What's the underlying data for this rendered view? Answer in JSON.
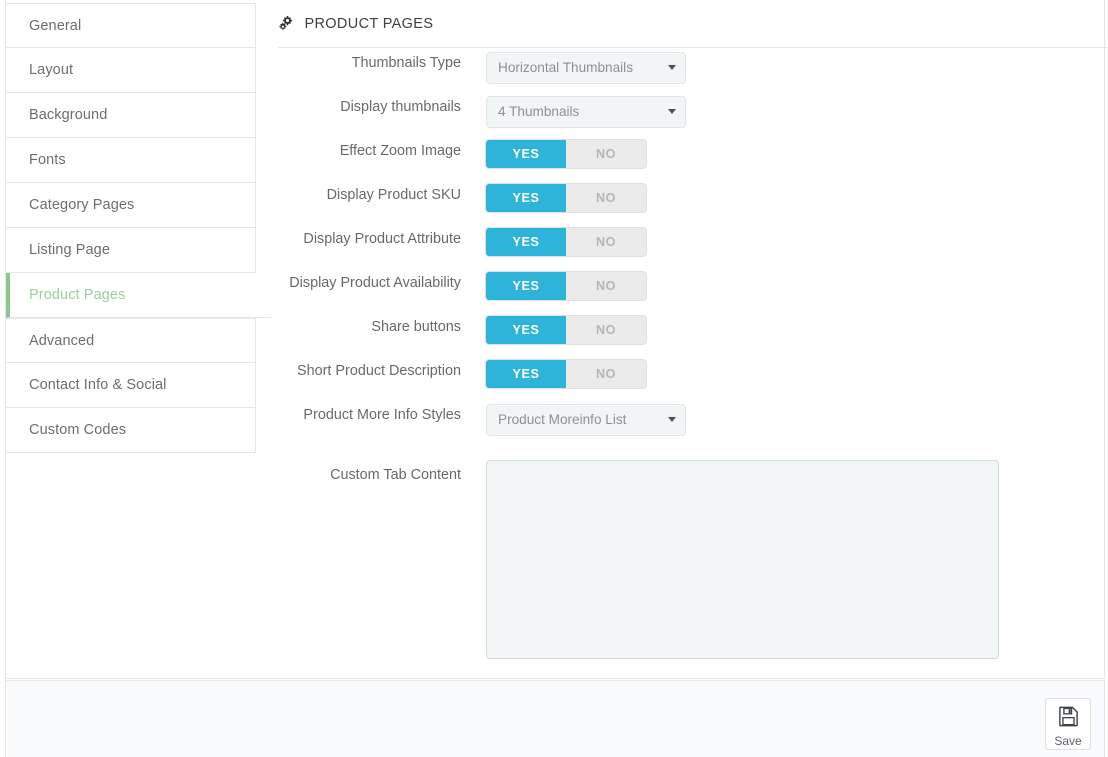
{
  "sidebar": {
    "items": [
      {
        "label": "General",
        "active": false
      },
      {
        "label": "Layout",
        "active": false
      },
      {
        "label": "Background",
        "active": false
      },
      {
        "label": "Fonts",
        "active": false
      },
      {
        "label": "Category Pages",
        "active": false
      },
      {
        "label": "Listing Page",
        "active": false
      },
      {
        "label": "Product Pages",
        "active": true
      },
      {
        "label": "Advanced",
        "active": false
      },
      {
        "label": "Contact Info & Social",
        "active": false
      },
      {
        "label": "Custom Codes",
        "active": false
      }
    ]
  },
  "header": {
    "icon": "cogs-icon",
    "title": "PRODUCT PAGES"
  },
  "form": {
    "rows": [
      {
        "label": "Thumbnails Type",
        "type": "select",
        "value": "Horizontal Thumbnails",
        "name": "thumbnails-type"
      },
      {
        "label": "Display thumbnails",
        "type": "select",
        "value": "4 Thumbnails",
        "name": "display-thumbnails"
      },
      {
        "label": "Effect Zoom Image",
        "type": "toggle",
        "value": "YES",
        "yes_label": "YES",
        "no_label": "NO",
        "name": "effect-zoom-image"
      },
      {
        "label": "Display Product SKU",
        "type": "toggle",
        "value": "YES",
        "yes_label": "YES",
        "no_label": "NO",
        "name": "display-product-sku"
      },
      {
        "label": "Display Product Attribute",
        "type": "toggle",
        "value": "YES",
        "yes_label": "YES",
        "no_label": "NO",
        "name": "display-product-attribute"
      },
      {
        "label": "Display Product Availability",
        "type": "toggle",
        "value": "YES",
        "yes_label": "YES",
        "no_label": "NO",
        "name": "display-product-availability"
      },
      {
        "label": "Share buttons",
        "type": "toggle",
        "value": "YES",
        "yes_label": "YES",
        "no_label": "NO",
        "name": "share-buttons"
      },
      {
        "label": "Short Product Description",
        "type": "toggle",
        "value": "YES",
        "yes_label": "YES",
        "no_label": "NO",
        "name": "short-product-description"
      },
      {
        "label": "Product More Info Styles",
        "type": "select",
        "value": "Product Moreinfo List",
        "name": "product-more-info-styles"
      }
    ],
    "textarea": {
      "label": "Custom Tab Content",
      "value": "",
      "placeholder": "",
      "name": "custom-tab-content"
    }
  },
  "footer": {
    "save_label": "Save",
    "save_icon": "floppy-disk-icon"
  },
  "colors": {
    "toggle_on": "#2fb4d9",
    "toggle_off": "#ebebeb",
    "active_nav": "#9dcd9d",
    "active_nav_border": "#8cc78c",
    "label_text": "#666a6e",
    "select_bg": "#f1f5f6",
    "textarea_bg": "#f2f6f7",
    "footer_bg": "#fafbfd"
  }
}
